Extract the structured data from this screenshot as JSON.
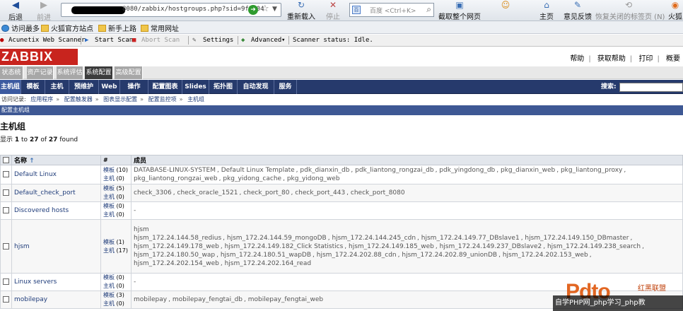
{
  "browser": {
    "back_label": "后退",
    "forward_label": "前进",
    "url": "8080/zabbix/hostgroups.php?sid=9f2604",
    "reload_label": "重新载入",
    "stop_label": "停止",
    "search_placeholder": "百度 <Ctrl+K>",
    "capture_label": "截取整个网页",
    "home_label": "主页",
    "feedback_label": "意见反馈",
    "restore_label": "恢复关闭的标签页 (N)",
    "extra_label": "火狐"
  },
  "bookmarks": [
    {
      "label": "访问最多",
      "icon": "globe-icon"
    },
    {
      "label": "火狐官方站点",
      "icon": "folder-icon"
    },
    {
      "label": "新手上路",
      "icon": "folder-icon"
    },
    {
      "label": "常用网址",
      "icon": "folder-icon"
    }
  ],
  "acunetix": {
    "title": "Acunetix Web Scanner",
    "start": "Start Scan",
    "abort": "Abort Scan",
    "settings": "Settings",
    "advanced": "Advanced",
    "status": "Scanner status: Idle."
  },
  "zabbix": {
    "logo": "ZABBIX",
    "top_links": [
      "帮助",
      "获取帮助",
      "打印",
      "概要"
    ],
    "main_menu": [
      {
        "label": "状态统计",
        "active": false
      },
      {
        "label": "资产记录",
        "active": false
      },
      {
        "label": "系统评估",
        "active": false
      },
      {
        "label": "系统配置",
        "active": true
      },
      {
        "label": "高级配置",
        "active": false
      }
    ],
    "sub_menu": [
      {
        "label": "主机组",
        "active": true
      },
      {
        "label": "模板",
        "active": false
      },
      {
        "label": "主机",
        "active": false
      },
      {
        "label": "预维护",
        "active": false
      },
      {
        "label": "Web",
        "active": false
      },
      {
        "label": "操作",
        "active": false
      },
      {
        "label": "配置图表",
        "active": false
      },
      {
        "label": "Slides",
        "active": false
      },
      {
        "label": "拓扑图",
        "active": false
      },
      {
        "label": "自动发现",
        "active": false
      },
      {
        "label": "服务",
        "active": false
      }
    ],
    "search_label": "搜索:",
    "breadcrumb_label": "访问记录:",
    "breadcrumbs": [
      "应用程序",
      "配置触发器",
      "图表显示配置",
      "配置监控项",
      "主机组"
    ],
    "config_bar": "配置主机组",
    "page_title": "主机组",
    "count_prefix": "显示",
    "count_from": "1",
    "count_to_word": "to",
    "count_to": "27",
    "count_of": "of",
    "count_total": "27",
    "count_suffix": "found",
    "columns": {
      "name": "名称",
      "count": "#",
      "members": "成员"
    },
    "rows": [
      {
        "name": "Default Linux",
        "templates_label": "模板",
        "templates": "(10)",
        "hosts_label": "主机",
        "hosts": "(0)",
        "members": [
          "DATABASE-LINUX-SYSTEM",
          "Default Linux Template",
          "pdk_dianxin_db",
          "pdk_liantong_rongzai_db",
          "pdk_yingdong_db",
          "pkg_dianxin_web",
          "pkg_liantong_proxy",
          "pkg_liantong_rongzai_web",
          "pkg_yidong_cache",
          "pkg_yidong_web"
        ]
      },
      {
        "name": "Default_check_port",
        "templates_label": "模板",
        "templates": "(5)",
        "hosts_label": "主机",
        "hosts": "(0)",
        "members": [
          "check_3306",
          "check_oracle_1521",
          "check_port_80",
          "check_port_443",
          "check_port_8080"
        ]
      },
      {
        "name": "Discovered hosts",
        "templates_label": "模板",
        "templates": "(0)",
        "hosts_label": "主机",
        "hosts": "(0)",
        "members": [
          "-"
        ]
      },
      {
        "name": "hjsm",
        "templates_label": "模板",
        "templates": "(1)",
        "hosts_label": "主机",
        "hosts": "(17)",
        "template_members": [
          "hjsm"
        ],
        "members": [
          "hjsm_172.24.144.58_redius",
          "hjsm_172.24.144.59_mongoDB",
          "hjsm_172.24.144.245_cdn",
          "hjsm_172.24.149.77_DBslave1",
          "hjsm_172.24.149.150_DBmaster",
          "hjsm_172.24.149.178_web",
          "hjsm_172.24.149.182_Click Statistics",
          "hjsm_172.24.149.185_web",
          "hjsm_172.24.149.237_DBslave2",
          "hjsm_172.24.149.238_search",
          "hjsm_172.24.180.50_wap",
          "hjsm_172.24.180.51_wapDB",
          "hjsm_172.24.202.88_cdn",
          "hjsm_172.24.202.89_unionDB",
          "hjsm_172.24.202.153_web",
          "hjsm_172.24.202.154_web",
          "hjsm_172.24.202.164_read"
        ]
      },
      {
        "name": "Linux servers",
        "templates_label": "模板",
        "templates": "(0)",
        "hosts_label": "主机",
        "hosts": "(0)",
        "members": [
          "-"
        ]
      },
      {
        "name": "mobilepay",
        "templates_label": "模板",
        "templates": "(3)",
        "hosts_label": "主机",
        "hosts": "(0)",
        "members": [
          "mobilepay",
          "mobilepay_fengtai_db",
          "mobilepay_fengtai_web"
        ]
      }
    ]
  },
  "watermark": {
    "logo": "Pdto",
    "cn": "红黑联盟",
    "line": "自学PHP网_php学习_php教"
  }
}
